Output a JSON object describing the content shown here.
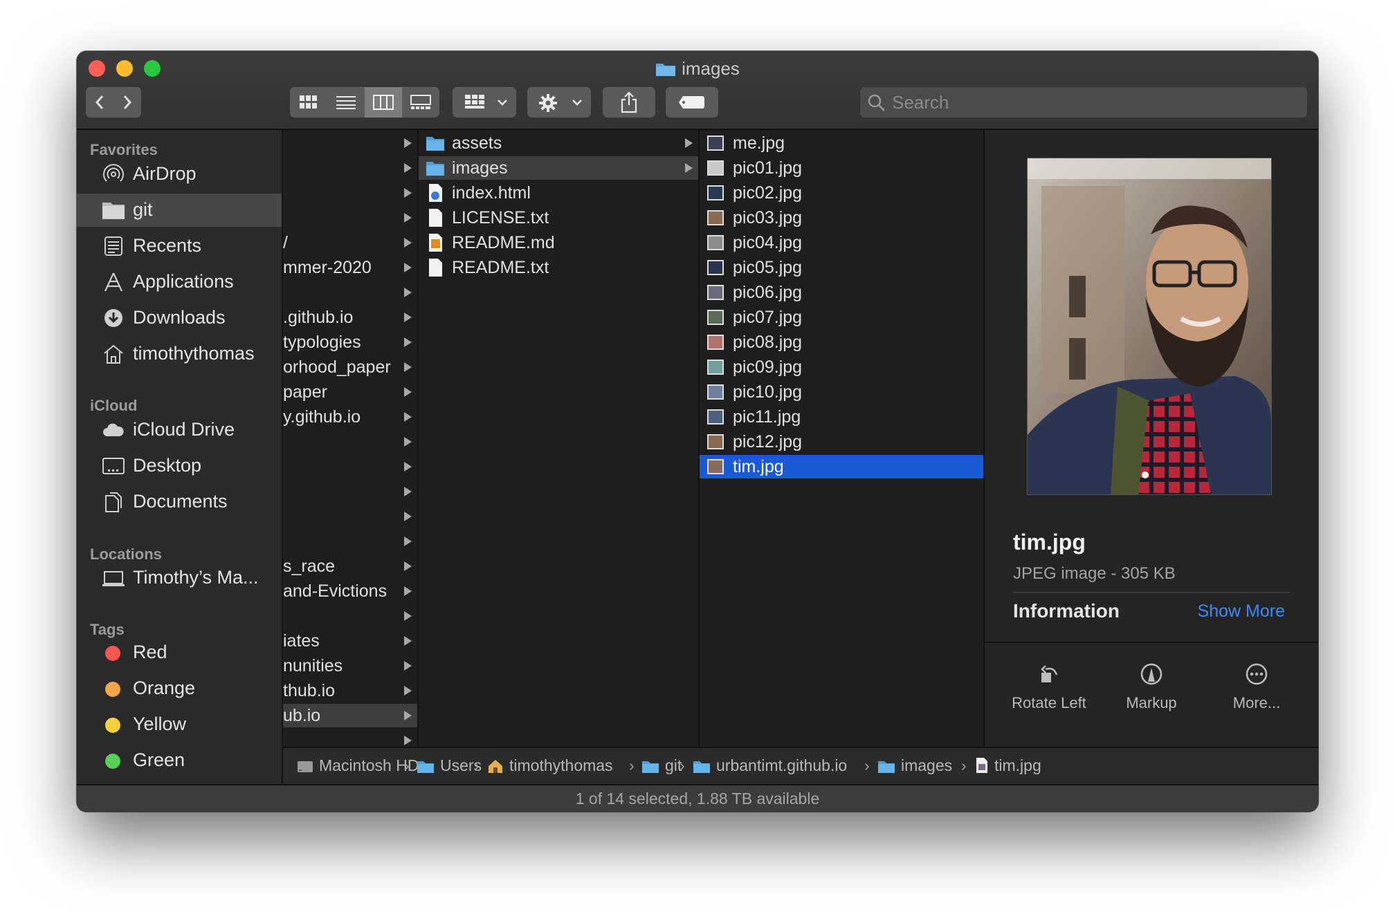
{
  "window": {
    "title": "images"
  },
  "toolbar": {
    "search_placeholder": "Search"
  },
  "sidebar": {
    "favorites_header": "Favorites",
    "favorites": [
      "AirDrop",
      "git",
      "Recents",
      "Applications",
      "Downloads",
      "timothythomas"
    ],
    "icloud_header": "iCloud",
    "icloud": [
      "iCloud Drive",
      "Desktop",
      "Documents"
    ],
    "locations_header": "Locations",
    "locations": [
      "Timothy’s Ma..."
    ],
    "tags_header": "Tags",
    "tags": [
      {
        "label": "Red",
        "color": "#f2574f"
      },
      {
        "label": "Orange",
        "color": "#f4a545"
      },
      {
        "label": "Yellow",
        "color": "#f5d03a"
      },
      {
        "label": "Green",
        "color": "#56d056"
      }
    ]
  },
  "columns": {
    "col1": [
      "",
      "",
      "",
      "",
      "/",
      "mmer-2020",
      "",
      ".github.io",
      "typologies",
      "orhood_paper",
      "paper",
      "y.github.io",
      "",
      "",
      "",
      "",
      "",
      "s_race",
      "and-Evictions",
      "",
      "iates",
      "nunities",
      "thub.io",
      "ub.io",
      ""
    ],
    "col2": [
      "assets",
      "images",
      "index.html",
      "LICENSE.txt",
      "README.md",
      "README.txt"
    ],
    "col3": [
      "me.jpg",
      "pic01.jpg",
      "pic02.jpg",
      "pic03.jpg",
      "pic04.jpg",
      "pic05.jpg",
      "pic06.jpg",
      "pic07.jpg",
      "pic08.jpg",
      "pic09.jpg",
      "pic10.jpg",
      "pic11.jpg",
      "pic12.jpg",
      "tim.jpg"
    ]
  },
  "preview": {
    "filename": "tim.jpg",
    "meta": "JPEG image - 305 KB",
    "info_label": "Information",
    "show_more": "Show More",
    "actions": [
      "Rotate Left",
      "Markup",
      "More..."
    ]
  },
  "pathbar": [
    "Macintosh HD",
    "Users",
    "timothythomas",
    "git",
    "urbantimt.github.io",
    "images",
    "tim.jpg"
  ],
  "status": "1 of 14 selected, 1.88 TB available",
  "colors": {
    "accent": "#1b5ad6",
    "link": "#3b8bf5"
  }
}
